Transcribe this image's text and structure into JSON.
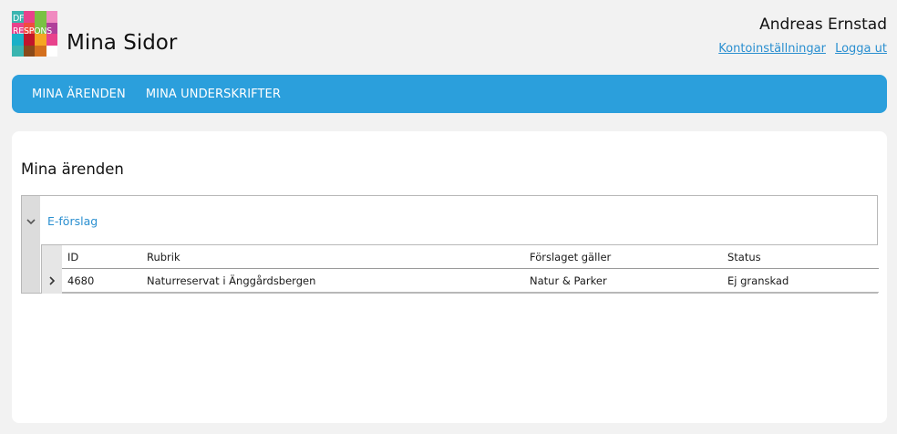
{
  "header": {
    "logo": {
      "line1": "DF",
      "line2": "RESPONS",
      "colors": [
        "#3ab5b0",
        "#e8428c",
        "#7ac143",
        "#f08ac0",
        "#e8428c",
        "#f04e3e",
        "#7ac143",
        "#b0409a",
        "#1ab0c8",
        "#c0162c",
        "#f5a623",
        "#e8428c",
        "#3ab5b0",
        "#8a4a1a",
        "#d4701e",
        "#ffffff"
      ]
    },
    "site_title": "Mina Sidor",
    "user_name": "Andreas Ernstad",
    "links": {
      "account": "Kontoinställningar",
      "logout": "Logga ut"
    }
  },
  "nav": {
    "items": [
      {
        "label": "MINA ÄRENDEN"
      },
      {
        "label": "MINA UNDERSKRIFTER"
      }
    ],
    "color": "#2b9fdc"
  },
  "main": {
    "title": "Mina ärenden",
    "group": {
      "label": "E-förslag",
      "columns": {
        "id": "ID",
        "rubrik": "Rubrik",
        "forslaget": "Förslaget gäller",
        "status": "Status"
      },
      "rows": [
        {
          "id": "4680",
          "rubrik": "Naturreservat i Änggårdsbergen",
          "forslaget": "Natur & Parker",
          "status": "Ej granskad"
        }
      ]
    }
  },
  "icons": {
    "group_toggle": "chevron-down-icon",
    "row_toggle": "chevron-right-icon"
  }
}
